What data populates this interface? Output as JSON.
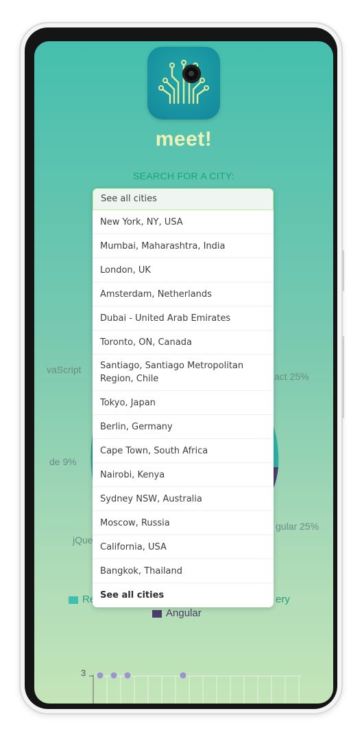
{
  "app": {
    "name": "meet!",
    "search_label": "SEARCH FOR A CITY:"
  },
  "search": {
    "value": "See all cities"
  },
  "suggestions": [
    "New York, NY, USA",
    "Mumbai, Maharashtra, India",
    "London, UK",
    "Amsterdam, Netherlands",
    "Dubai - United Arab Emirates",
    "Toronto, ON, Canada",
    "Santiago, Santiago Metropolitan Region, Chile",
    "Tokyo, Japan",
    "Berlin, Germany",
    "Cape Town, South Africa",
    "Nairobi, Kenya",
    "Sydney NSW, Australia",
    "Moscow, Russia",
    "California, USA",
    "Bangkok, Thailand"
  ],
  "see_all": "See all cities",
  "background_chart": {
    "visible_labels": [
      "vaScript",
      "act 25%",
      "de 9%",
      "gular 25%",
      "jQue"
    ],
    "legend": [
      {
        "label": "Re",
        "color": "#3cc1b1"
      },
      {
        "label": "ery",
        "color": "#2c9c77"
      },
      {
        "label": "Angular",
        "color": "#4b3d6e"
      }
    ]
  },
  "scatter_stub": {
    "y_tick": "3",
    "point_color": "#9d93d1"
  },
  "colors": {
    "gradient_top": "#45bfae",
    "gradient_bottom": "#c4e5b8",
    "title": "#eef1b8",
    "label_green": "#16a66f"
  }
}
